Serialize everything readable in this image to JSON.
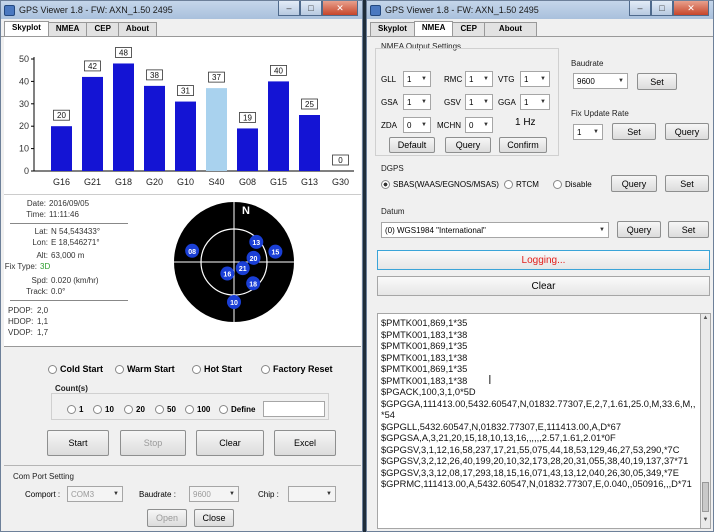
{
  "left_window": {
    "title": "GPS Viewer 1.8 - FW: AXN_1.50 2495",
    "tabs": [
      "Skyplot",
      "NMEA",
      "CEP",
      "About"
    ],
    "active_tab": "Skyplot",
    "info": {
      "date_label": "Date:",
      "date": "2016/09/05",
      "time_label": "Time:",
      "time": "11:11:46",
      "lat_label": "Lat:",
      "lat": "N 54,543433°",
      "lon_label": "Lon:",
      "lon": "E 18,546271°",
      "alt_label": "Alt:",
      "alt": "63,000 m",
      "fix_label": "Fix Type:",
      "fix": "3D",
      "spd_label": "Spd:",
      "spd": "0.020 (km/hr)",
      "track_label": "Track:",
      "track": "0.0°",
      "pdop_label": "PDOP:",
      "pdop": "2,0",
      "hdop_label": "HDOP:",
      "hdop": "1,1",
      "vdop_label": "VDOP:",
      "vdop": "1,7"
    },
    "skyplot": {
      "north_label": "N",
      "satellites": [
        {
          "id": "13",
          "az": 48,
          "el": 45
        },
        {
          "id": "08",
          "az": 285,
          "el": 25
        },
        {
          "id": "20",
          "az": 78,
          "el": 60
        },
        {
          "id": "15",
          "az": 76,
          "el": 26
        },
        {
          "id": "21",
          "az": 125,
          "el": 74
        },
        {
          "id": "16",
          "az": 210,
          "el": 70
        },
        {
          "id": "18",
          "az": 138,
          "el": 47
        },
        {
          "id": "10",
          "az": 180,
          "el": 30
        }
      ]
    },
    "start_options": {
      "cold": "Cold Start",
      "warm": "Warm Start",
      "hot": "Hot Start",
      "factory": "Factory Reset",
      "count_label": "Count(s)",
      "counts": [
        "1",
        "10",
        "20",
        "50",
        "100",
        "Define"
      ],
      "define_value": ""
    },
    "buttons": {
      "start": "Start",
      "stop": "Stop",
      "clear": "Clear",
      "excel": "Excel"
    },
    "com_port": {
      "group_label": "Com Port Setting",
      "comport_label": "Comport :",
      "comport_value": "COM3",
      "baud_label": "Baudrate :",
      "baud_value": "9600",
      "chip_label": "Chip :",
      "chip_value": "",
      "open": "Open",
      "close": "Close"
    }
  },
  "chart_data": {
    "type": "bar",
    "categories": [
      "G16",
      "G21",
      "G18",
      "G20",
      "G10",
      "S40",
      "G08",
      "G15",
      "G13",
      "G30"
    ],
    "values": [
      20,
      42,
      48,
      38,
      31,
      37,
      19,
      40,
      25,
      0
    ],
    "highlight_index": 5,
    "bar_color": "#1414d4",
    "highlight_color": "#a9d2ee",
    "ylim": [
      0,
      50
    ],
    "yticks": [
      0,
      10,
      20,
      30,
      40,
      50
    ],
    "xlabel": "",
    "ylabel": "",
    "grid": false
  },
  "right_window": {
    "title": "GPS Viewer 1.8 - FW: AXN_1.50 2495",
    "tabs": [
      "Skyplot",
      "NMEA",
      "CEP",
      "About"
    ],
    "active_tab": "NMEA",
    "nmea_output": {
      "group_label": "NMEA Output Settings",
      "rows": [
        [
          {
            "label": "GLL",
            "value": "1"
          },
          {
            "label": "RMC",
            "value": "1"
          },
          {
            "label": "VTG",
            "value": "1"
          }
        ],
        [
          {
            "label": "GSA",
            "value": "1"
          },
          {
            "label": "GSV",
            "value": "1"
          },
          {
            "label": "GGA",
            "value": "1"
          }
        ],
        [
          {
            "label": "ZDA",
            "value": "0"
          },
          {
            "label": "MCHN",
            "value": "0"
          }
        ]
      ],
      "rate": "1 Hz",
      "default": "Default",
      "query": "Query",
      "confirm": "Confirm"
    },
    "baudrate": {
      "label": "Baudrate",
      "value": "9600",
      "set": "Set"
    },
    "fix_rate": {
      "label": "Fix Update Rate",
      "value": "1",
      "set": "Set",
      "query": "Query"
    },
    "dgps": {
      "label": "DGPS",
      "sbas": "SBAS(WAAS/EGNOS/MSAS)",
      "rtcm": "RTCM",
      "disable": "Disable",
      "query": "Query",
      "set": "Set"
    },
    "datum": {
      "label": "Datum",
      "value": "(0) WGS1984 \"International\"",
      "query": "Query",
      "set": "Set"
    },
    "logging": "Logging...",
    "clear": "Clear",
    "log_lines": [
      "$PMTK001,869,1*35",
      "$PMTK001,183,1*38",
      "$PMTK001,869,1*35",
      "$PMTK001,183,1*38",
      "$PMTK001,869,1*35",
      "$PMTK001,183,1*38",
      "$PGACK,100,3,1,0*5D",
      "$GPGGA,111413.00,5432.60547,N,01832.77307,E,2,7,1.61,25.0,M,33.6,M,,*54",
      "$GPGLL,5432.60547,N,01832.77307,E,111413.00,A,D*67",
      "$GPGSA,A,3,21,20,15,18,10,13,16,,,,,,2.57,1.61,2.01*0F",
      "$GPGSV,3,1,12,16,58,237,17,21,55,075,44,18,53,129,46,27,53,290,*7C",
      "$GPGSV,3,2,12,26,40,199,20,10,32,173,28,20,31,055,38,40,19,137,37*71",
      "$GPGSV,3,3,12,08,17,293,18,15,16,071,43,13,12,040,26,30,05,349,*7E",
      "$GPRMC,111413.00,A,5432.60547,N,01832.77307,E,0.040,,050916,,,D*71"
    ]
  }
}
